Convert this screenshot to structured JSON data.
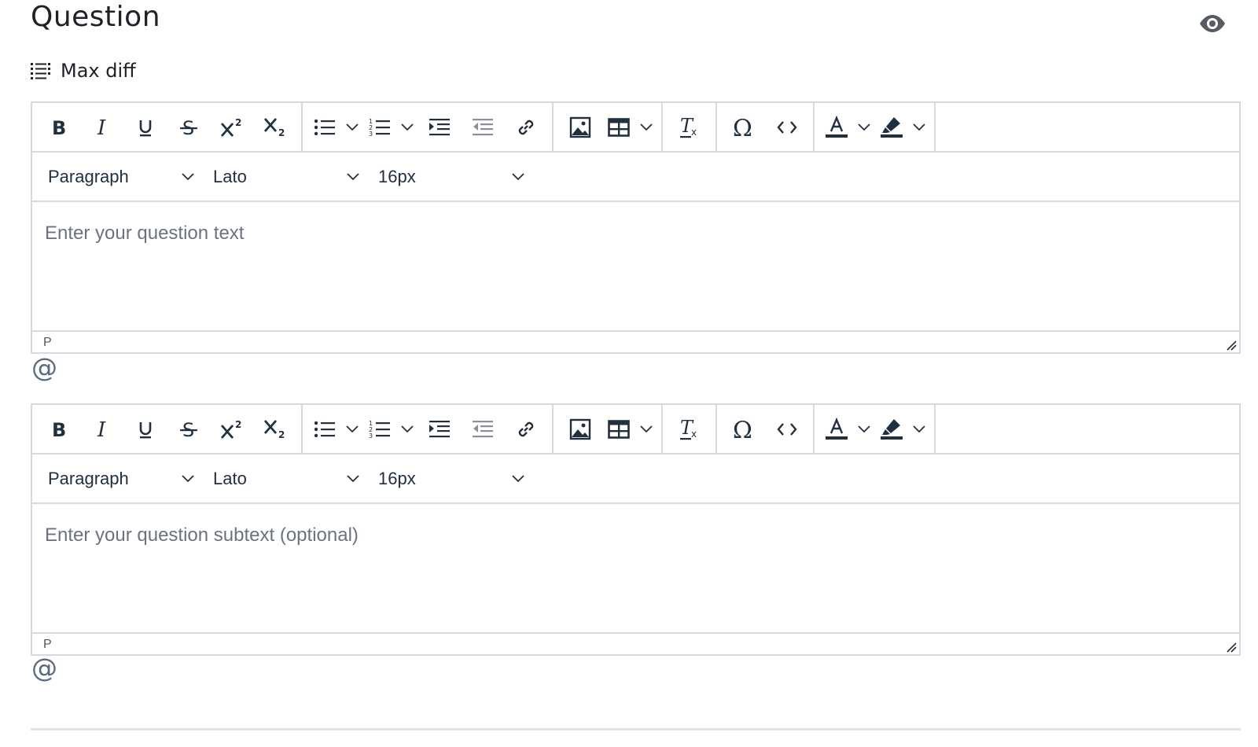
{
  "header": {
    "title": "Question",
    "question_type": "Max diff"
  },
  "editors": [
    {
      "format_block": "Paragraph",
      "font_family": "Lato",
      "font_size": "16px",
      "placeholder": "Enter your question text",
      "status_path": "P"
    },
    {
      "format_block": "Paragraph",
      "font_family": "Lato",
      "font_size": "16px",
      "placeholder": "Enter your question subtext (optional)",
      "status_path": "P"
    }
  ],
  "toolbar_icons": [
    "bold-icon",
    "italic-icon",
    "underline-icon",
    "strikethrough-icon",
    "superscript-icon",
    "subscript-icon",
    "bullet-list-icon",
    "numbered-list-icon",
    "indent-icon",
    "outdent-icon",
    "link-icon",
    "image-icon",
    "table-icon",
    "clear-formatting-icon",
    "special-character-icon",
    "source-code-icon",
    "text-color-icon",
    "highlight-color-icon"
  ],
  "colors": {
    "text": "#222f3e",
    "border": "#d6d9de",
    "placeholder": "#6b7280",
    "mention": "#5b6b7d"
  }
}
